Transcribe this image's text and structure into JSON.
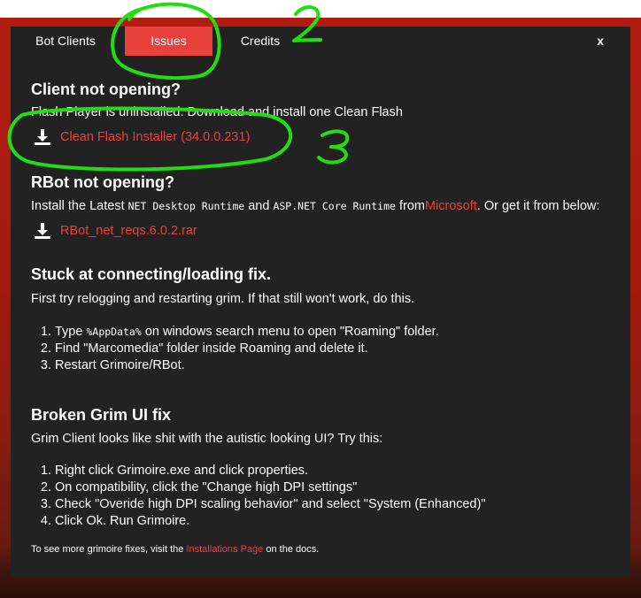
{
  "tabs": [
    {
      "label": "Bot Clients",
      "active": false
    },
    {
      "label": "Issues",
      "active": true
    },
    {
      "label": "Credits",
      "active": false
    }
  ],
  "close_label": "x",
  "accent_color": "#e8413d",
  "annotation_color": "#22dd11",
  "sections": {
    "client": {
      "heading": "Client not opening?",
      "text": "Flash Player is uninstalled. Download and install one Clean Flash",
      "download_label": "Clean Flash Installer (34.0.0.231)",
      "download_icon": "download-icon"
    },
    "rbot": {
      "heading": "RBot not opening?",
      "text_1": "Install the Latest",
      "code_1": "NET Desktop Runtime",
      "text_2": "and",
      "code_2": "ASP.NET Core Runtime",
      "text_3": "from",
      "link": "Microsoft",
      "text_4": ". Or get it from below:",
      "download_label": "RBot_net_reqs.6.0.2.rar",
      "download_icon": "download-icon"
    },
    "stuck": {
      "heading": "Stuck at connecting/loading fix.",
      "text": "First try relogging and restarting grim. If that still won't work, do this.",
      "step1_pre": "Type",
      "step1_code": "%AppData%",
      "step1_post": "on windows search menu to open \"Roaming\" folder.",
      "step2": "Find \"Marcomedia\" folder inside Roaming and delete it.",
      "step3": "Restart Grimoire/RBot."
    },
    "grim": {
      "heading": "Broken Grim UI fix",
      "text": "Grim Client looks like shit with the autistic looking UI? Try this:",
      "steps": [
        "Right click Grimoire.exe and click properties.",
        "On compatibility, click the \"Change high DPI settings\"",
        "Check \"Overide high DPI scaling behavior\" and select \"System (Enhanced)\"",
        "Click Ok. Run Grimoire."
      ]
    },
    "footer": {
      "text_pre": "To see more grimoire fixes, visit the",
      "link": "Installations Page",
      "text_post": "on the docs."
    }
  },
  "annotations": [
    "2",
    "3"
  ]
}
